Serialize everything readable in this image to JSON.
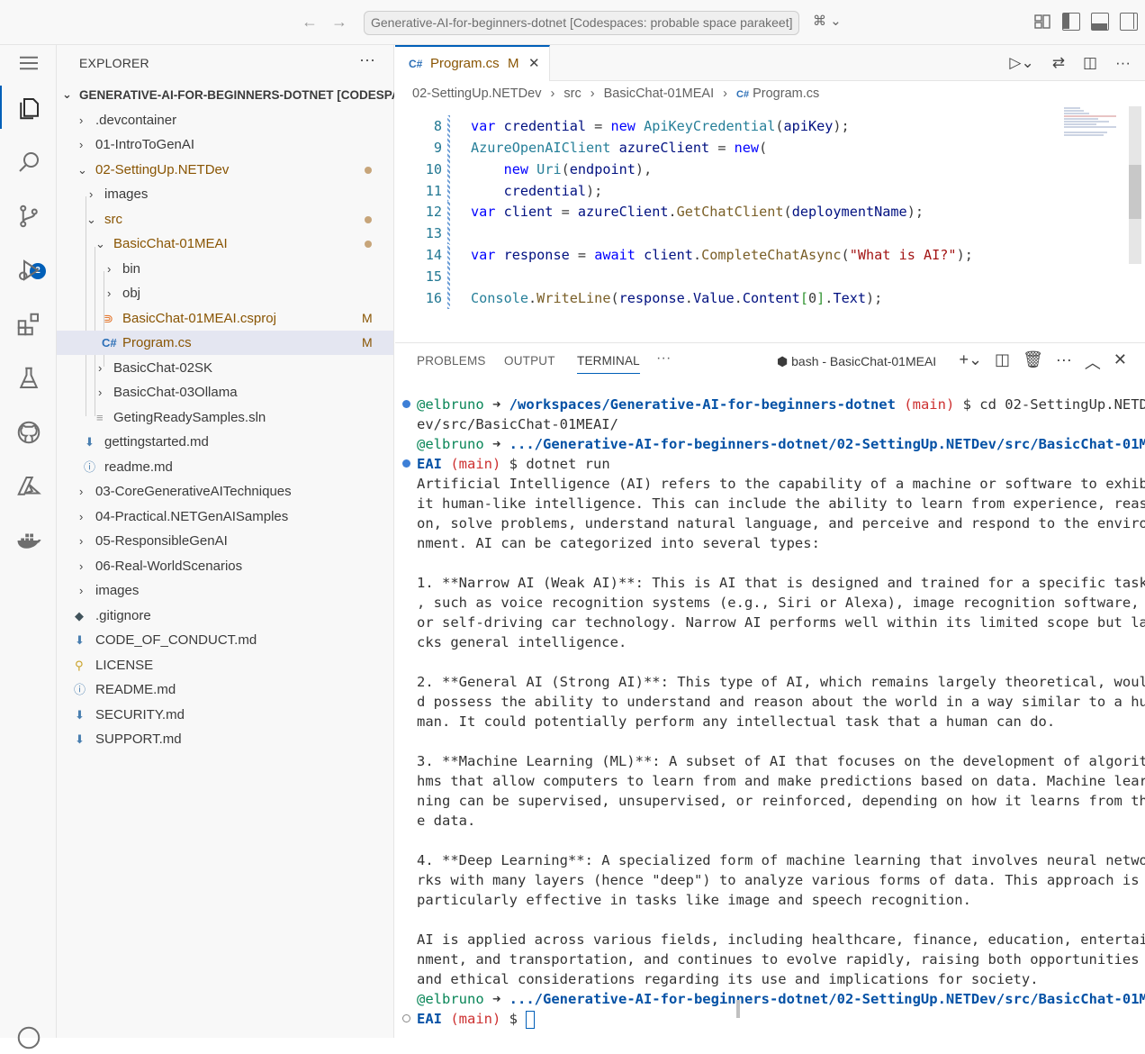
{
  "titlebar": {
    "back": "←",
    "forward": "→",
    "command_center": "Generative-AI-for-beginners-dotnet [Codespaces: probable space parakeet]",
    "copilot": "⌘ ⌄"
  },
  "activity": {
    "scm_badge": "2"
  },
  "explorer": {
    "title": "EXPLORER",
    "more": "···",
    "root": "GENERATIVE-AI-FOR-BEGINNERS-DOTNET [CODESPACES: PROBABLE SPACE PARAKEET]",
    "items": [
      {
        "label": ".devcontainer",
        "type": "folder"
      },
      {
        "label": "01-IntroToGenAI",
        "type": "folder"
      },
      {
        "label": "02-SettingUp.NETDev",
        "type": "folder-open"
      },
      {
        "label": "images",
        "type": "folder"
      },
      {
        "label": "src",
        "type": "folder-open"
      },
      {
        "label": "BasicChat-01MEAI",
        "type": "folder-open"
      },
      {
        "label": "bin",
        "type": "folder"
      },
      {
        "label": "obj",
        "type": "folder"
      },
      {
        "label": "BasicChat-01MEAI.csproj",
        "type": "file",
        "status": "M"
      },
      {
        "label": "Program.cs",
        "type": "file",
        "status": "M"
      },
      {
        "label": "BasicChat-02SK",
        "type": "folder"
      },
      {
        "label": "BasicChat-03Ollama",
        "type": "folder"
      },
      {
        "label": "GetingReadySamples.sln",
        "type": "file"
      },
      {
        "label": "gettingstarted.md",
        "type": "file"
      },
      {
        "label": "readme.md",
        "type": "file"
      },
      {
        "label": "03-CoreGenerativeAITechniques",
        "type": "folder"
      },
      {
        "label": "04-Practical.NETGenAISamples",
        "type": "folder"
      },
      {
        "label": "05-ResponsibleGenAI",
        "type": "folder"
      },
      {
        "label": "06-Real-WorldScenarios",
        "type": "folder"
      },
      {
        "label": "images",
        "type": "folder"
      },
      {
        "label": ".gitignore",
        "type": "file"
      },
      {
        "label": "CODE_OF_CONDUCT.md",
        "type": "file"
      },
      {
        "label": "LICENSE",
        "type": "file"
      },
      {
        "label": "README.md",
        "type": "file"
      },
      {
        "label": "SECURITY.md",
        "type": "file"
      },
      {
        "label": "SUPPORT.md",
        "type": "file"
      }
    ]
  },
  "editor": {
    "tab_label": "Program.cs",
    "tab_status": "M",
    "tab_close": "✕",
    "breadcrumb": [
      "02-SettingUp.NETDev",
      "src",
      "BasicChat-01MEAI",
      "Program.cs"
    ],
    "line_numbers": [
      "8",
      "9",
      "10",
      "11",
      "12",
      "13",
      "14",
      "15",
      "16"
    ]
  },
  "panel": {
    "tabs": [
      "PROBLEMS",
      "OUTPUT",
      "TERMINAL"
    ],
    "more": "···",
    "terminal_name": "bash - BasicChat-01MEAI",
    "terminal": {
      "user": "@elbruno",
      "arrow": " ➜",
      "path1": "/workspaces/Generative-AI-for-beginners-dotnet",
      "branch": "(main)",
      "cmd1a": " $ cd 02-SettingUp.NETD",
      "cmd1b": "ev/src/BasicChat-01MEAI/",
      "path2": ".../Generative-AI-for-beginners-dotnet/02-SettingUp.NETDev/src/BasicChat-01M",
      "path2b": "EAI",
      "cmd2": " $ dotnet run",
      "prompt_end": " $ ",
      "output": [
        "Artificial Intelligence (AI) refers to the capability of a machine or software to exhib",
        "it human-like intelligence. This can include the ability to learn from experience, reas",
        "on, solve problems, understand natural language, and perceive and respond to the enviro",
        "nment. AI can be categorized into several types:",
        "",
        "1. **Narrow AI (Weak AI)**: This is AI that is designed and trained for a specific task",
        ", such as voice recognition systems (e.g., Siri or Alexa), image recognition software,",
        "or self-driving car technology. Narrow AI performs well within its limited scope but la",
        "cks general intelligence.",
        "",
        "2. **General AI (Strong AI)**: This type of AI, which remains largely theoretical, woul",
        "d possess the ability to understand and reason about the world in a way similar to a hu",
        "man. It could potentially perform any intellectual task that a human can do.",
        "",
        "3. **Machine Learning (ML)**: A subset of AI that focuses on the development of algorit",
        "hms that allow computers to learn from and make predictions based on data. Machine lear",
        "ning can be supervised, unsupervised, or reinforced, depending on how it learns from th",
        "e data.",
        "",
        "4. **Deep Learning**: A specialized form of machine learning that involves neural netwo",
        "rks with many layers (hence \"deep\") to analyze various forms of data. This approach is",
        "particularly effective in tasks like image and speech recognition.",
        "",
        "AI is applied across various fields, including healthcare, finance, education, entertai",
        "nment, and transportation, and continues to evolve rapidly, raising both opportunities",
        "and ethical considerations regarding its use and implications for society."
      ]
    }
  },
  "colors": {
    "accent": "#005fb8",
    "modified": "#895503"
  }
}
